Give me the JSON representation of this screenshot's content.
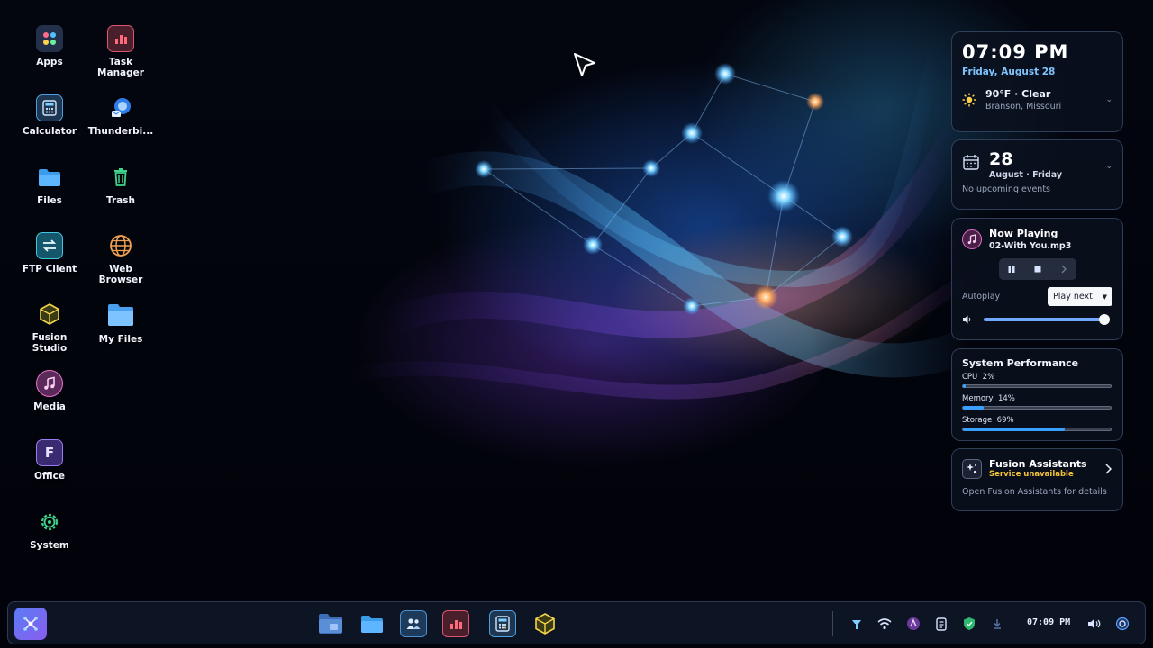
{
  "desktop": {
    "icons": [
      {
        "label": "Apps",
        "icon": "apps-grid-icon"
      },
      {
        "label": "Task\nManager",
        "icon": "task-manager-icon"
      },
      {
        "label": "Calculator",
        "icon": "calculator-icon"
      },
      {
        "label": "Thunderbi...",
        "icon": "thunderbird-icon"
      },
      {
        "label": "Files",
        "icon": "folder-icon"
      },
      {
        "label": "Trash",
        "icon": "trash-icon"
      },
      {
        "label": "FTP Client",
        "icon": "ftp-icon"
      },
      {
        "label": "Web\nBrowser",
        "icon": "globe-icon"
      },
      {
        "label": "Fusion\nStudio",
        "icon": "cube-icon"
      },
      {
        "label": "My Files",
        "icon": "folder-icon"
      },
      {
        "label": "Media",
        "icon": "music-note-icon"
      },
      {
        "label": "Office",
        "icon": "office-icon"
      },
      {
        "label": "System",
        "icon": "gear-icon"
      }
    ]
  },
  "clock_widget": {
    "time": "07:09 PM",
    "date": "Friday, August 28",
    "weather": "90°F · Clear",
    "location": "Branson, Missouri"
  },
  "calendar_widget": {
    "day": "28",
    "subtitle": "August · Friday",
    "events": "No upcoming events"
  },
  "media_widget": {
    "title": "Now Playing",
    "track": "02-With You.mp3",
    "autoplay_label": "Autoplay",
    "autoplay_value": "Play next",
    "volume": 1.0
  },
  "perf_widget": {
    "title": "System Performance",
    "cpu_label": "CPU  2%",
    "cpu": 2,
    "memory_label": "Memory  14%",
    "memory": 14,
    "storage_label": "Storage  69%",
    "storage": 69
  },
  "assistant_widget": {
    "title": "Fusion Assistants",
    "status": "Service unavailable",
    "hint": "Open Fusion Assistants for details"
  },
  "taskbar": {
    "clock": "07:09 PM",
    "accent": "#3b82f6"
  }
}
